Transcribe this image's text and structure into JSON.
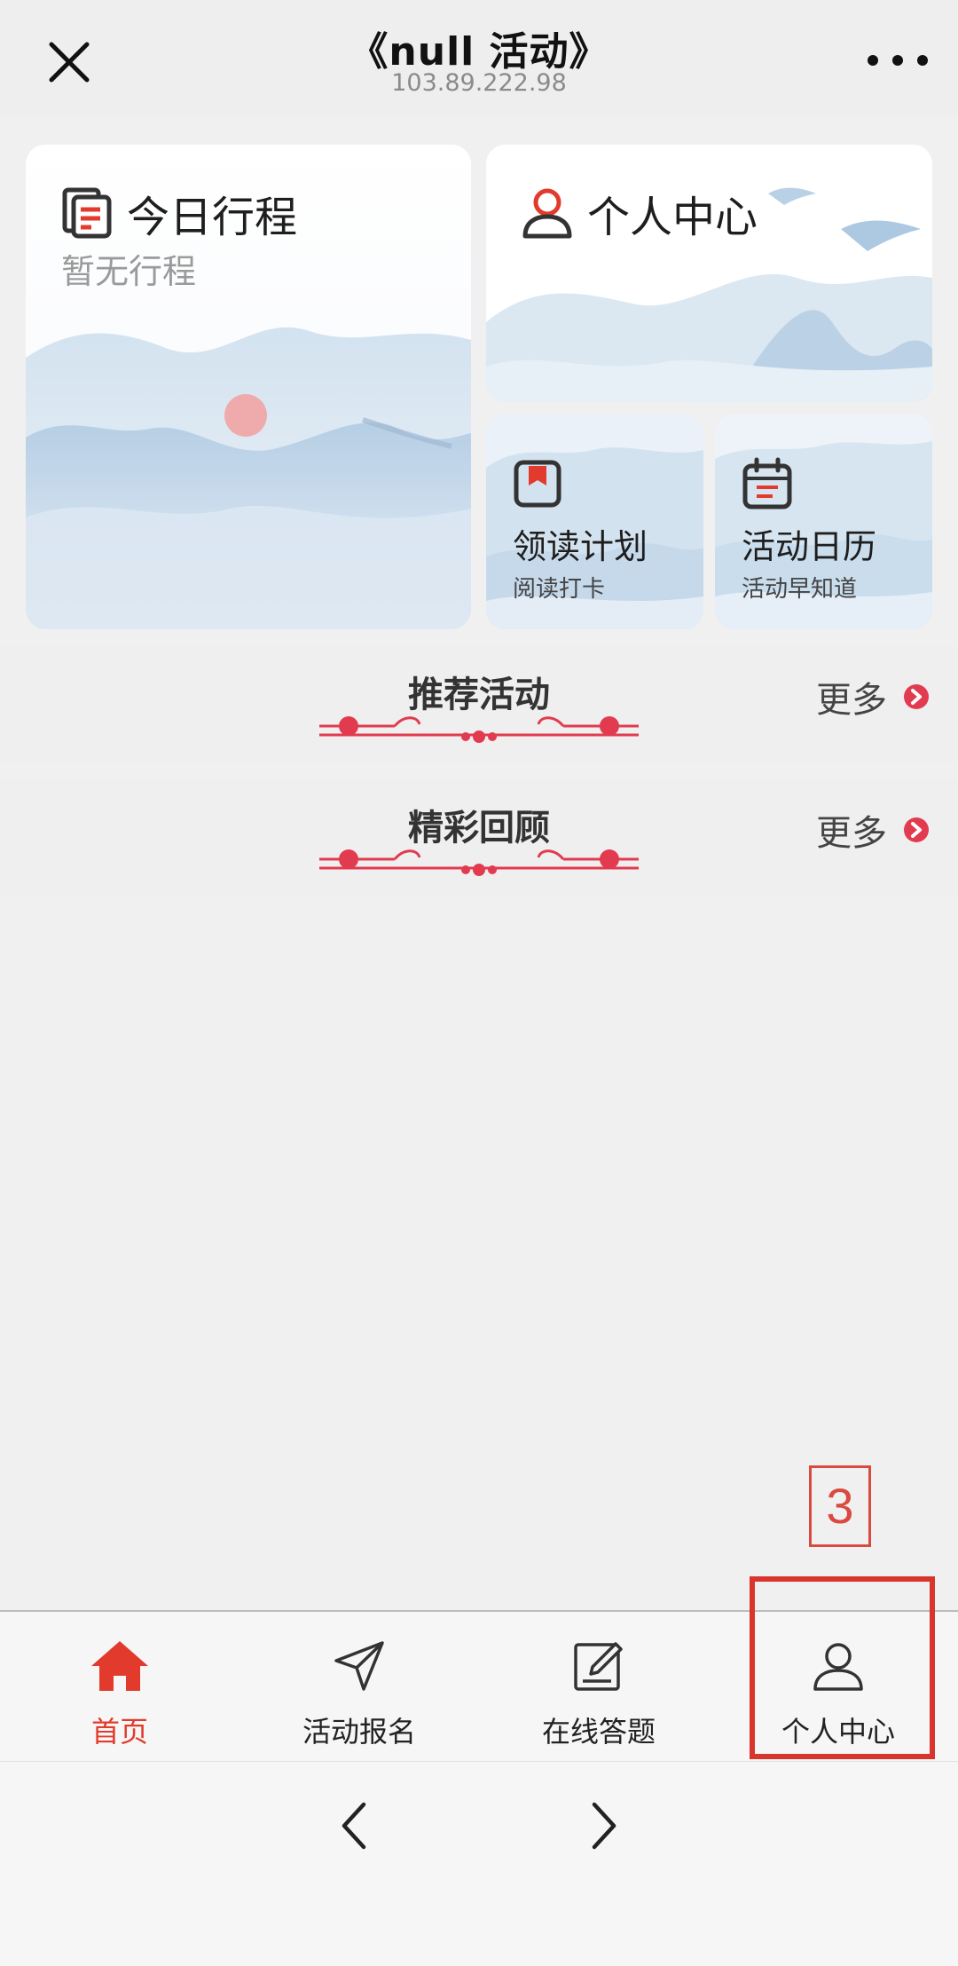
{
  "topbar": {
    "title": "《null 活动》",
    "subtitle": "103.89.222.98"
  },
  "cards": {
    "today": {
      "title": "今日行程",
      "subtitle": "暂无行程"
    },
    "personal": {
      "title": "个人中心"
    },
    "reading_plan": {
      "title": "领读计划",
      "subtitle": "阅读打卡"
    },
    "activity_calendar": {
      "title": "活动日历",
      "subtitle": "活动早知道"
    }
  },
  "sections": [
    {
      "title": "推荐活动",
      "more": "更多"
    },
    {
      "title": "精彩回顾",
      "more": "更多"
    }
  ],
  "tabbar": {
    "items": [
      {
        "label": "首页",
        "icon": "home-icon",
        "active": true
      },
      {
        "label": "活动报名",
        "icon": "send-icon",
        "active": false
      },
      {
        "label": "在线答题",
        "icon": "edit-icon",
        "active": false
      },
      {
        "label": "个人中心",
        "icon": "user-icon",
        "active": false
      }
    ]
  },
  "annotation": {
    "number": "3"
  },
  "colors": {
    "accent": "#e23b2d",
    "annotation": "#d8362c",
    "background": "#f1f0f0"
  }
}
